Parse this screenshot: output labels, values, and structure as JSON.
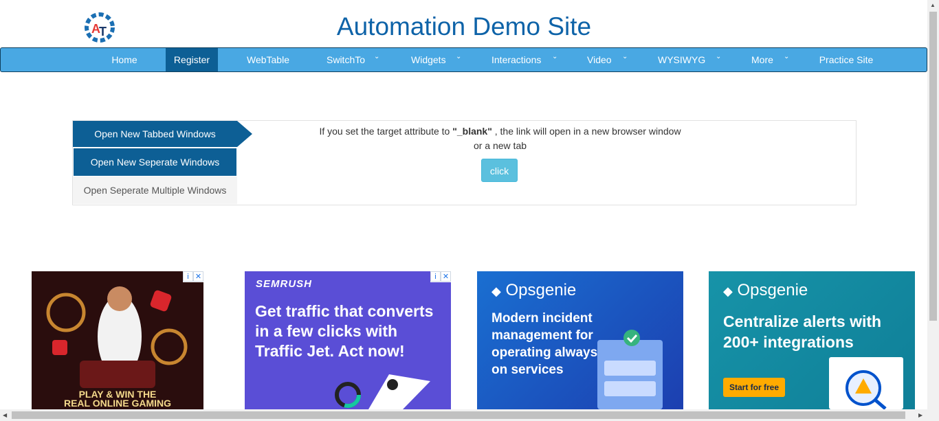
{
  "header": {
    "title": "Automation Demo Site",
    "logo_letters": "AT"
  },
  "nav": {
    "items": [
      {
        "label": "Home",
        "has_dropdown": false,
        "active": false
      },
      {
        "label": "Register",
        "has_dropdown": false,
        "active": true
      },
      {
        "label": "WebTable",
        "has_dropdown": false,
        "active": false
      },
      {
        "label": "SwitchTo",
        "has_dropdown": true,
        "active": false
      },
      {
        "label": "Widgets",
        "has_dropdown": true,
        "active": false
      },
      {
        "label": "Interactions",
        "has_dropdown": true,
        "active": false
      },
      {
        "label": "Video",
        "has_dropdown": true,
        "active": false
      },
      {
        "label": "WYSIWYG",
        "has_dropdown": true,
        "active": false
      },
      {
        "label": "More",
        "has_dropdown": true,
        "active": false
      },
      {
        "label": "Practice Site",
        "has_dropdown": false,
        "active": false
      }
    ],
    "chevron": "⌄"
  },
  "windows": {
    "tabs": [
      {
        "label": "Open New Tabbed Windows",
        "selected": true
      },
      {
        "label": "Open New Seperate Windows",
        "selected": false
      },
      {
        "label": "Open Seperate Multiple Windows",
        "selected": false
      }
    ],
    "description_before": "If you set the target attribute to ",
    "description_keyword": "\"_blank\"",
    "description_after": " , the link will open in a new browser window",
    "description_line2": "or a new tab",
    "button_label": "click"
  },
  "ads": {
    "info_icon": "i",
    "close_icon": "✕",
    "ad1": {
      "promo_line1": "PLAY & WIN THE",
      "promo_line2": "REAL ONLINE GAMING"
    },
    "ad2": {
      "brand": "SEMRUSH",
      "headline": "Get traffic that converts in a few clicks with Traffic Jet. Act now!"
    },
    "ad3": {
      "brand": "Opsgenie",
      "headline": "Modern incident management for operating always-on services"
    },
    "ad4": {
      "brand": "Opsgenie",
      "headline": "Centralize alerts with 200+ integrations",
      "cta": "Start for free"
    }
  },
  "colors": {
    "navbar": "#49a8e3",
    "nav_active": "#0d5f95",
    "title": "#0e63a8",
    "click_button": "#5bc0de"
  }
}
